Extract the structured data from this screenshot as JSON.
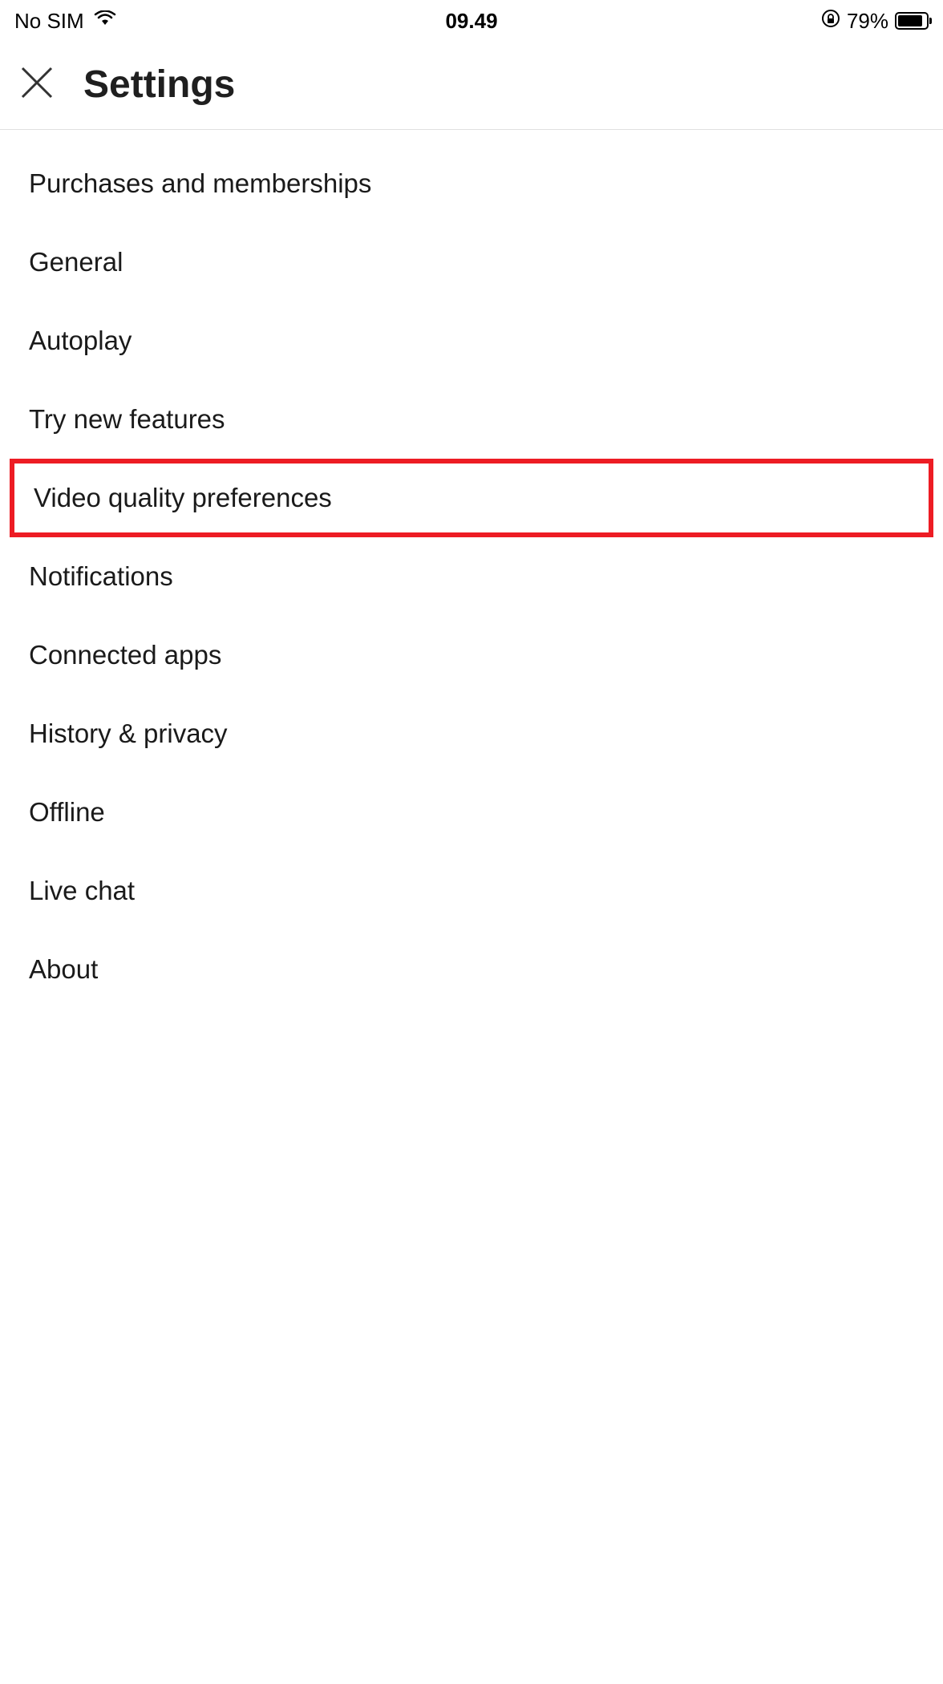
{
  "status_bar": {
    "carrier": "No SIM",
    "time": "09.49",
    "battery_percent": "79%"
  },
  "header": {
    "title": "Settings"
  },
  "settings": {
    "items": [
      {
        "label": "Purchases and memberships",
        "highlighted": false
      },
      {
        "label": "General",
        "highlighted": false
      },
      {
        "label": "Autoplay",
        "highlighted": false
      },
      {
        "label": "Try new features",
        "highlighted": false
      },
      {
        "label": "Video quality preferences",
        "highlighted": true
      },
      {
        "label": "Notifications",
        "highlighted": false
      },
      {
        "label": "Connected apps",
        "highlighted": false
      },
      {
        "label": "History & privacy",
        "highlighted": false
      },
      {
        "label": "Offline",
        "highlighted": false
      },
      {
        "label": "Live chat",
        "highlighted": false
      },
      {
        "label": "About",
        "highlighted": false
      }
    ]
  }
}
